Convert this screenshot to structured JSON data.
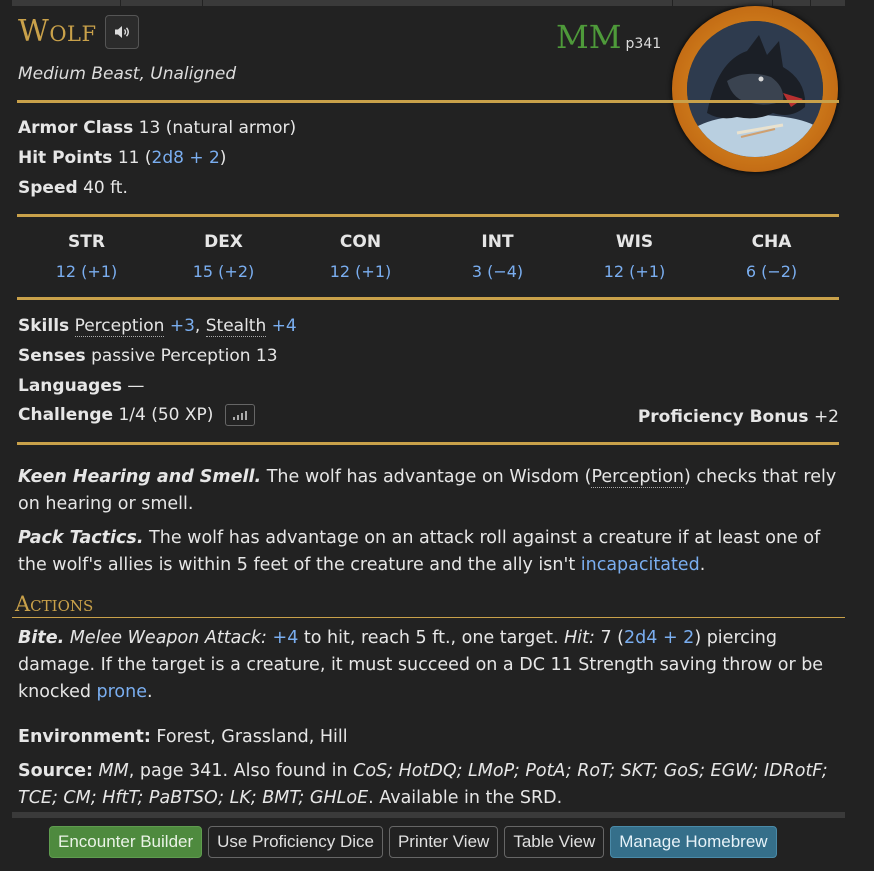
{
  "creature": {
    "name": "Wolf",
    "type": "Medium Beast, Unaligned",
    "source_abbr": "MM",
    "source_page": "p341"
  },
  "stats": {
    "ac_label": "Armor Class",
    "ac_value": "13 (natural armor)",
    "hp_label": "Hit Points",
    "hp_value": "11 (",
    "hp_dice": "2d8 + 2",
    "hp_close": ")",
    "speed_label": "Speed",
    "speed_value": "40 ft."
  },
  "abilities": [
    {
      "name": "STR",
      "value": "12 (+1)"
    },
    {
      "name": "DEX",
      "value": "15 (+2)"
    },
    {
      "name": "CON",
      "value": "12 (+1)"
    },
    {
      "name": "INT",
      "value": "3 (−4)"
    },
    {
      "name": "WIS",
      "value": "12 (+1)"
    },
    {
      "name": "CHA",
      "value": "6 (−2)"
    }
  ],
  "details": {
    "skills_label": "Skills",
    "skill1": "Perception",
    "skill1_bonus": "+3",
    "sep": ",",
    "skill2": "Stealth",
    "skill2_bonus": "+4",
    "senses_label": "Senses",
    "senses_value": "passive Perception 13",
    "languages_label": "Languages",
    "languages_value": "—",
    "challenge_label": "Challenge",
    "challenge_value": "1/4 (50 XP)",
    "prof_label": "Proficiency Bonus",
    "prof_value": "+2"
  },
  "traits": {
    "t1_name": "Keen Hearing and Smell.",
    "t1_a": " The wolf has advantage on Wisdom (",
    "t1_link": "Perception",
    "t1_b": ") checks that rely on hearing or smell.",
    "t2_name": "Pack Tactics.",
    "t2_a": " The wolf has advantage on an attack roll against a creature if at least one of the wolf's allies is within 5 feet of the creature and the ally isn't ",
    "t2_link": "incapacitated",
    "t2_b": "."
  },
  "actions": {
    "heading": "Actions",
    "bite_name": "Bite.",
    "bite_type": " Melee Weapon Attack:",
    "bite_bonus": " +4",
    "bite_a": " to hit, reach 5 ft., one target. ",
    "hit_label": "Hit:",
    "bite_b": " 7 (",
    "bite_dice": "2d4 + 2",
    "bite_c": ") piercing damage. If the target is a creature, it must succeed on a DC 11 Strength saving throw or be knocked ",
    "bite_link": "prone",
    "bite_d": "."
  },
  "footer": {
    "env_label": "Environment:",
    "env_value": " Forest, Grassland, Hill",
    "source_label": "Source:",
    "source_book": " MM",
    "source_rest": ", page 341. Also found in ",
    "source_list": "CoS; HotDQ; LMoP; PotA; RoT; SKT; GoS; EGW; IDRotF; TCE; CM; HftT; PaBTSO; LK; BMT; GHLoE",
    "source_end": ". Available in the SRD."
  },
  "buttons": {
    "encounter": "Encounter Builder",
    "prof_dice": "Use Proficiency Dice",
    "printer": "Printer View",
    "table": "Table View",
    "homebrew": "Manage Homebrew"
  },
  "colors": {
    "gold": "#c9a14a",
    "link": "#7aaef0",
    "source_green": "#4e9a3a",
    "button_green": "#4e8a3e",
    "button_blue": "#356f8a"
  }
}
